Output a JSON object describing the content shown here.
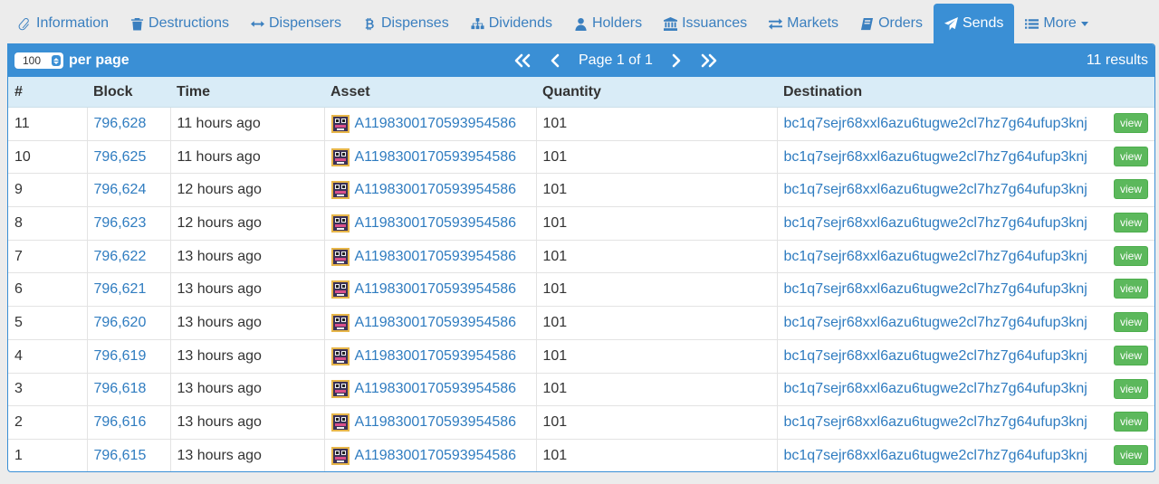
{
  "tabs": [
    {
      "label": "Information",
      "icon": "paperclip-icon"
    },
    {
      "label": "Destructions",
      "icon": "trash-icon"
    },
    {
      "label": "Dispensers",
      "icon": "arrows-horizontal-icon"
    },
    {
      "label": "Dispenses",
      "icon": "bitcoin-icon"
    },
    {
      "label": "Dividends",
      "icon": "sitemap-icon"
    },
    {
      "label": "Holders",
      "icon": "user-icon"
    },
    {
      "label": "Issuances",
      "icon": "bank-icon"
    },
    {
      "label": "Markets",
      "icon": "exchange-icon"
    },
    {
      "label": "Orders",
      "icon": "book-icon"
    },
    {
      "label": "Sends",
      "icon": "paper-plane-icon",
      "active": true
    },
    {
      "label": "More",
      "icon": "list-icon",
      "dropdown": true
    }
  ],
  "toolbar": {
    "per_page_value": "100",
    "per_page_label": "per page",
    "page_text": "Page 1 of 1",
    "results_text": "11 results"
  },
  "table": {
    "columns": [
      "#",
      "Block",
      "Time",
      "Asset",
      "Quantity",
      "Destination"
    ],
    "view_label": "view",
    "rows": [
      {
        "num": "11",
        "block": "796,628",
        "time": "11 hours ago",
        "asset": "A1198300170593954586",
        "quantity": "101",
        "destination": "bc1q7sejr68xxl6azu6tugwe2cl7hz7g64ufup3knj"
      },
      {
        "num": "10",
        "block": "796,625",
        "time": "11 hours ago",
        "asset": "A1198300170593954586",
        "quantity": "101",
        "destination": "bc1q7sejr68xxl6azu6tugwe2cl7hz7g64ufup3knj"
      },
      {
        "num": "9",
        "block": "796,624",
        "time": "12 hours ago",
        "asset": "A1198300170593954586",
        "quantity": "101",
        "destination": "bc1q7sejr68xxl6azu6tugwe2cl7hz7g64ufup3knj"
      },
      {
        "num": "8",
        "block": "796,623",
        "time": "12 hours ago",
        "asset": "A1198300170593954586",
        "quantity": "101",
        "destination": "bc1q7sejr68xxl6azu6tugwe2cl7hz7g64ufup3knj"
      },
      {
        "num": "7",
        "block": "796,622",
        "time": "13 hours ago",
        "asset": "A1198300170593954586",
        "quantity": "101",
        "destination": "bc1q7sejr68xxl6azu6tugwe2cl7hz7g64ufup3knj"
      },
      {
        "num": "6",
        "block": "796,621",
        "time": "13 hours ago",
        "asset": "A1198300170593954586",
        "quantity": "101",
        "destination": "bc1q7sejr68xxl6azu6tugwe2cl7hz7g64ufup3knj"
      },
      {
        "num": "5",
        "block": "796,620",
        "time": "13 hours ago",
        "asset": "A1198300170593954586",
        "quantity": "101",
        "destination": "bc1q7sejr68xxl6azu6tugwe2cl7hz7g64ufup3knj"
      },
      {
        "num": "4",
        "block": "796,619",
        "time": "13 hours ago",
        "asset": "A1198300170593954586",
        "quantity": "101",
        "destination": "bc1q7sejr68xxl6azu6tugwe2cl7hz7g64ufup3knj"
      },
      {
        "num": "3",
        "block": "796,618",
        "time": "13 hours ago",
        "asset": "A1198300170593954586",
        "quantity": "101",
        "destination": "bc1q7sejr68xxl6azu6tugwe2cl7hz7g64ufup3knj"
      },
      {
        "num": "2",
        "block": "796,616",
        "time": "13 hours ago",
        "asset": "A1198300170593954586",
        "quantity": "101",
        "destination": "bc1q7sejr68xxl6azu6tugwe2cl7hz7g64ufup3knj"
      },
      {
        "num": "1",
        "block": "796,615",
        "time": "13 hours ago",
        "asset": "A1198300170593954586",
        "quantity": "101",
        "destination": "bc1q7sejr68xxl6azu6tugwe2cl7hz7g64ufup3knj"
      }
    ]
  },
  "colors": {
    "accent": "#3a8fd5",
    "link": "#2f7cc0",
    "header_bg": "#d9ecf7",
    "view_button": "#5cb85c"
  }
}
